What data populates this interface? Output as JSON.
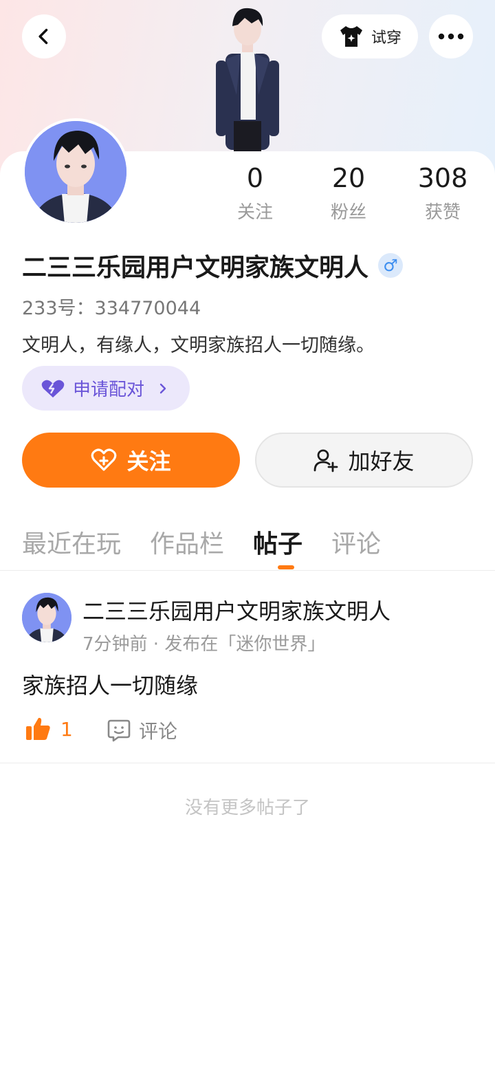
{
  "header": {
    "back_icon": "chevron-left-icon",
    "tryon_label": "试穿",
    "more_icon": "more-dots-icon"
  },
  "profile": {
    "stats": [
      {
        "value": "0",
        "label": "关注"
      },
      {
        "value": "20",
        "label": "粉丝"
      },
      {
        "value": "308",
        "label": "获赞"
      }
    ],
    "username": "二三三乐园用户文明家族文明人",
    "gender_symbol": "♂",
    "uid": "233号：334770044",
    "bio": "文明人，有缘人，文明家族招人一切随缘。",
    "pair_label": "申请配对"
  },
  "actions": {
    "follow_label": "关注",
    "add_friend_label": "加好友"
  },
  "tabs": [
    {
      "label": "最近在玩",
      "active": false
    },
    {
      "label": "作品栏",
      "active": false
    },
    {
      "label": "帖子",
      "active": true
    },
    {
      "label": "评论",
      "active": false
    }
  ],
  "post": {
    "author": "二三三乐园用户文明家族文明人",
    "meta": "7分钟前 · 发布在「迷你世界」",
    "text": "家族招人一切随缘",
    "likes": "1",
    "comment_label": "评论"
  },
  "footer": {
    "no_more": "没有更多帖子了"
  },
  "colors": {
    "accent": "#ff7a12",
    "pair_purple": "#6a55d8",
    "gender_blue": "#3d8ef0"
  }
}
